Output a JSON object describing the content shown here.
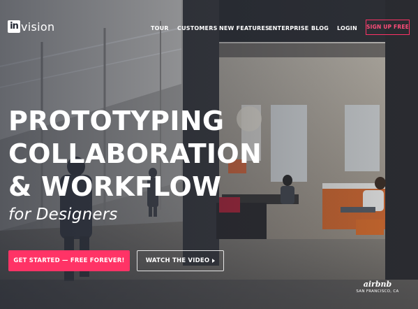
{
  "brand": {
    "logo_mark": "in",
    "logo_word": "vision"
  },
  "nav": {
    "links": [
      "TOUR",
      "CUSTOMERS",
      "NEW FEATURES",
      "ENTERPRISE",
      "BLOG",
      "LOGIN"
    ],
    "signup_label": "SIGN UP FREE"
  },
  "hero": {
    "headline_lines": [
      "PROTOTYPING",
      "COLLABORATION",
      "& WORKFLOW"
    ],
    "tagline": "for Designers",
    "primary_cta": "GET STARTED — FREE FOREVER!",
    "secondary_cta": "WATCH THE VIDEO",
    "secondary_cta_icon": "play-icon",
    "photo_credit_logo": "airbnb",
    "photo_credit_location": "SAN FRANCISCO, CA"
  },
  "colors": {
    "accent": "#ff3366",
    "text": "#ffffff",
    "overlay": "#1c212d"
  }
}
